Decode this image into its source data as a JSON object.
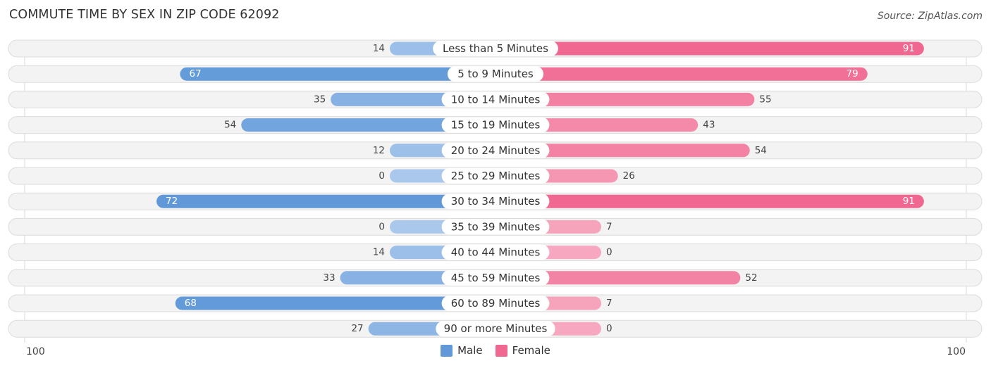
{
  "header": {
    "title": "COMMUTE TIME BY SEX IN ZIP CODE 62092",
    "source": "Source: ZipAtlas.com"
  },
  "colors": {
    "male_strong": "#6199d8",
    "male_light": "#aac8ec",
    "female_strong": "#f06892",
    "female_light": "#f7a8c0",
    "row_background": "#f3f3f3"
  },
  "legend": {
    "male_label": "Male",
    "female_label": "Female"
  },
  "chart_data": {
    "type": "bar",
    "orientation": "horizontal-diverging",
    "title": "COMMUTE TIME BY SEX IN ZIP CODE 62092",
    "xlabel": "",
    "ylabel": "",
    "xlim": [
      -100,
      100
    ],
    "tick_labels": {
      "left": "100",
      "right": "100"
    },
    "legend_position": "bottom-center",
    "categories": [
      "Less than 5 Minutes",
      "5 to 9 Minutes",
      "10 to 14 Minutes",
      "15 to 19 Minutes",
      "20 to 24 Minutes",
      "25 to 29 Minutes",
      "30 to 34 Minutes",
      "35 to 39 Minutes",
      "40 to 44 Minutes",
      "45 to 59 Minutes",
      "60 to 89 Minutes",
      "90 or more Minutes"
    ],
    "series": [
      {
        "name": "Male",
        "side": "left",
        "values": [
          14,
          67,
          35,
          54,
          12,
          0,
          72,
          0,
          14,
          33,
          68,
          27
        ]
      },
      {
        "name": "Female",
        "side": "right",
        "values": [
          91,
          79,
          55,
          43,
          54,
          26,
          91,
          7,
          0,
          52,
          7,
          0
        ]
      }
    ]
  }
}
